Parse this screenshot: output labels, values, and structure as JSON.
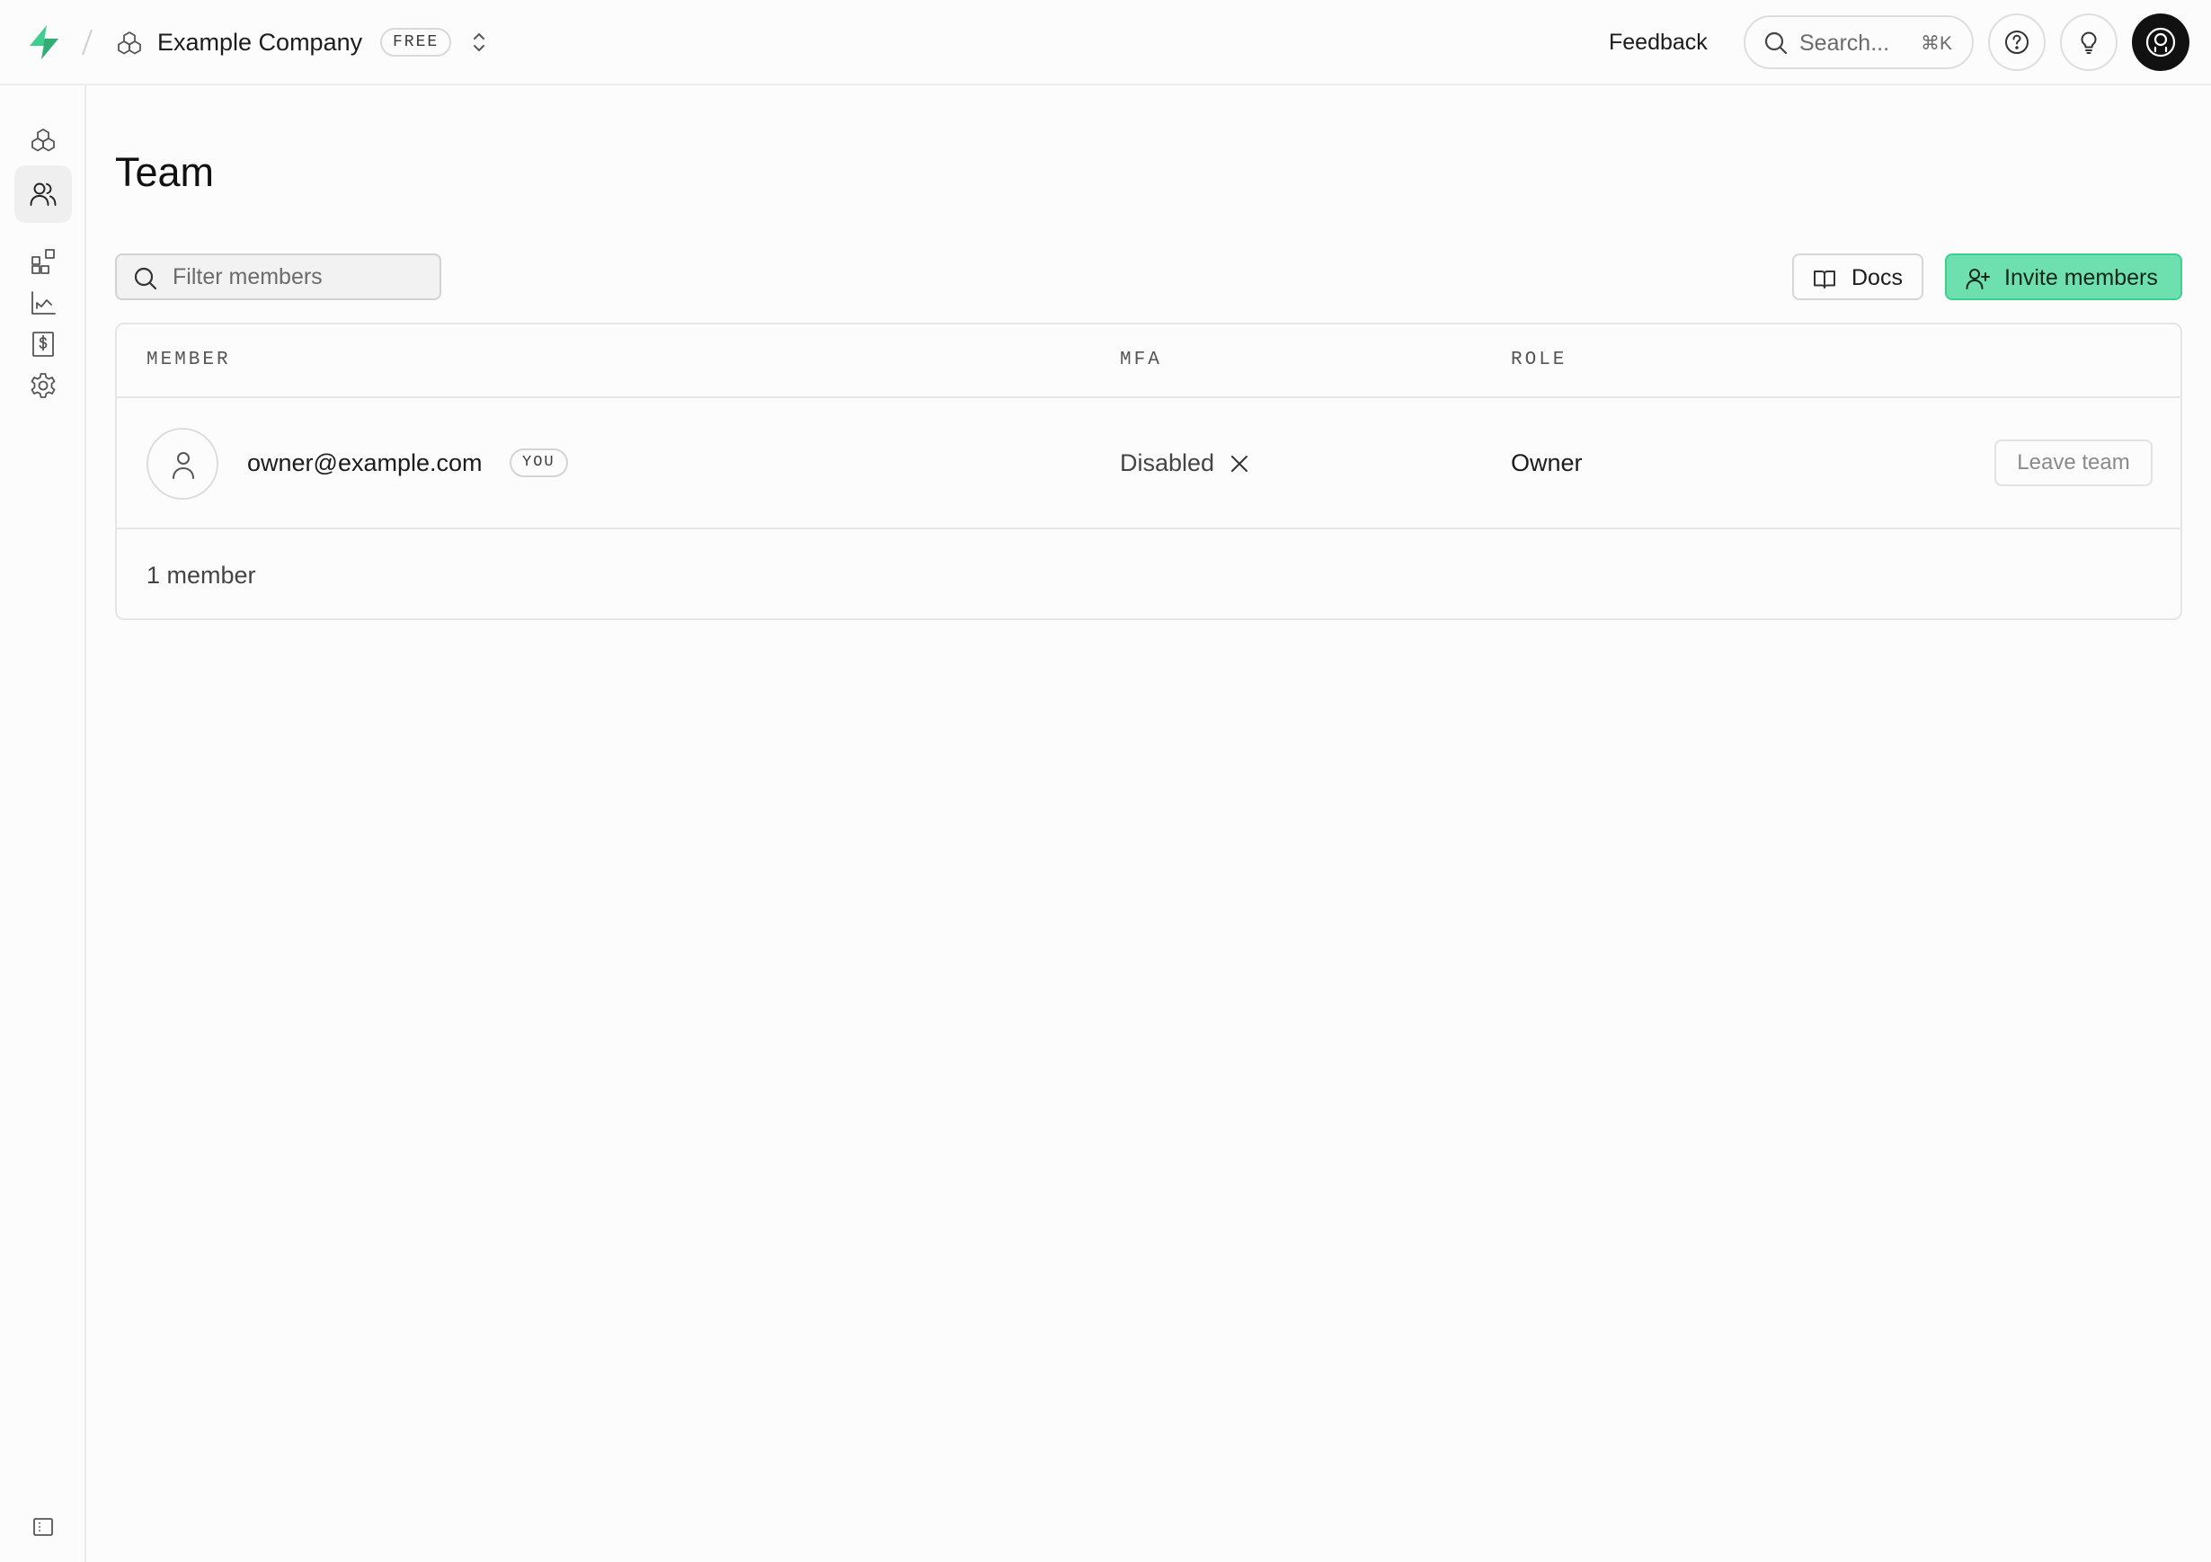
{
  "brand": {
    "accent": "#3ecf8e",
    "accent_fill": "#6ee0b0"
  },
  "header": {
    "org_name": "Example Company",
    "plan_badge": "FREE",
    "feedback_label": "Feedback",
    "search_placeholder": "Search...",
    "search_shortcut": "⌘K"
  },
  "siderail": {
    "items": [
      {
        "icon": "projects-icon",
        "active": false
      },
      {
        "icon": "team-icon",
        "active": true
      },
      {
        "icon": "integrations-icon",
        "active": false
      },
      {
        "icon": "usage-icon",
        "active": false
      },
      {
        "icon": "billing-icon",
        "active": false
      },
      {
        "icon": "settings-icon",
        "active": false
      }
    ]
  },
  "main": {
    "title": "Team",
    "filter_placeholder": "Filter members",
    "docs_label": "Docs",
    "invite_label": "Invite members"
  },
  "table": {
    "columns": [
      "MEMBER",
      "MFA",
      "ROLE"
    ],
    "rows": [
      {
        "email": "owner@example.com",
        "badge": "YOU",
        "mfa": "Disabled",
        "role": "Owner",
        "action": "Leave team"
      }
    ],
    "footer": "1 member"
  }
}
